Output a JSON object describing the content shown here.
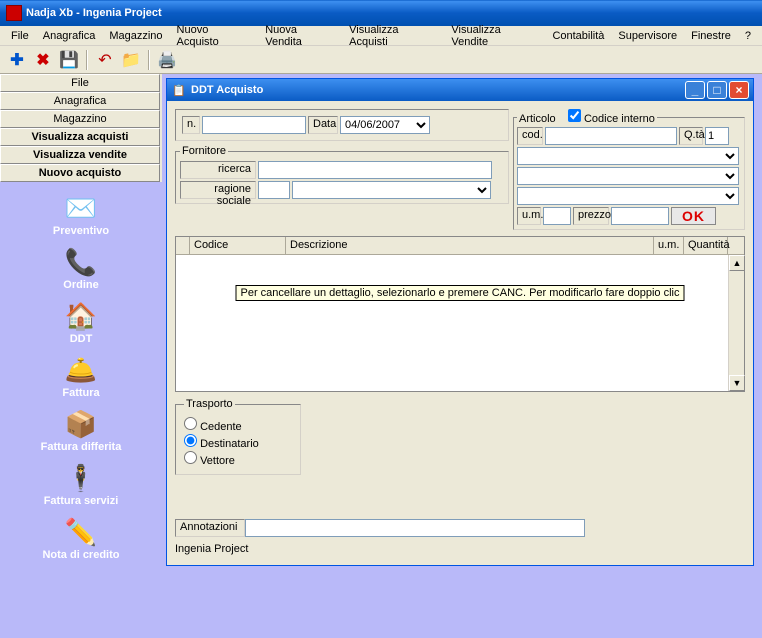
{
  "app": {
    "title": "Nadja Xb - Ingenia Project"
  },
  "menu": [
    "File",
    "Anagrafica",
    "Magazzino",
    "Nuovo Acquisto",
    "Nuova Vendita",
    "Visualizza Acquisti",
    "Visualizza Vendite",
    "Contabilità",
    "Supervisore",
    "Finestre",
    "?"
  ],
  "sidebar_buttons": [
    "File",
    "Anagrafica",
    "Magazzino",
    "Visualizza acquisti",
    "Visualizza vendite",
    "Nuovo acquisto"
  ],
  "sidebar_buttons_bold": [
    false,
    false,
    false,
    true,
    true,
    true
  ],
  "sidebar_icons": [
    {
      "label": "Preventivo",
      "emoji": "✉️"
    },
    {
      "label": "Ordine",
      "emoji": "📞"
    },
    {
      "label": "DDT",
      "emoji": "🏠"
    },
    {
      "label": "Fattura",
      "emoji": "🛎️"
    },
    {
      "label": "Fattura differita",
      "emoji": "📦"
    },
    {
      "label": "Fattura servizi",
      "emoji": "🕴️"
    },
    {
      "label": "Nota di credito",
      "emoji": "✏️"
    }
  ],
  "child": {
    "title": "DDT Acquisto",
    "n_label": "n.",
    "n_value": "",
    "data_label": "Data",
    "data_value": "04/06/2007",
    "fornitore_legend": "Fornitore",
    "ricerca_label": "ricerca",
    "ricerca_value": "",
    "ragione_label": "ragione sociale",
    "ragione_value": "",
    "articolo_legend": "Articolo",
    "codint_label": "Codice interno",
    "cod_label": "cod.",
    "cod_value": "",
    "qta_label": "Q.tà",
    "qta_value": "1",
    "um_label": "u.m.",
    "um_value": "",
    "prezzo_label": "prezzo",
    "prezzo_value": "",
    "ok_label": "OK",
    "grid_headers": [
      "Codice",
      "Descrizione",
      "u.m.",
      "Quantità"
    ],
    "grid_hint": "Per cancellare un dettaglio, selezionarlo e premere CANC. Per modificarlo fare doppio clic",
    "trasporto_legend": "Trasporto",
    "trasporto_options": [
      "Cedente",
      "Destinatario",
      "Vettore"
    ],
    "trasporto_selected": "Destinatario",
    "annot_label": "Annotazioni",
    "annot_value": "",
    "footer": "Ingenia Project"
  }
}
